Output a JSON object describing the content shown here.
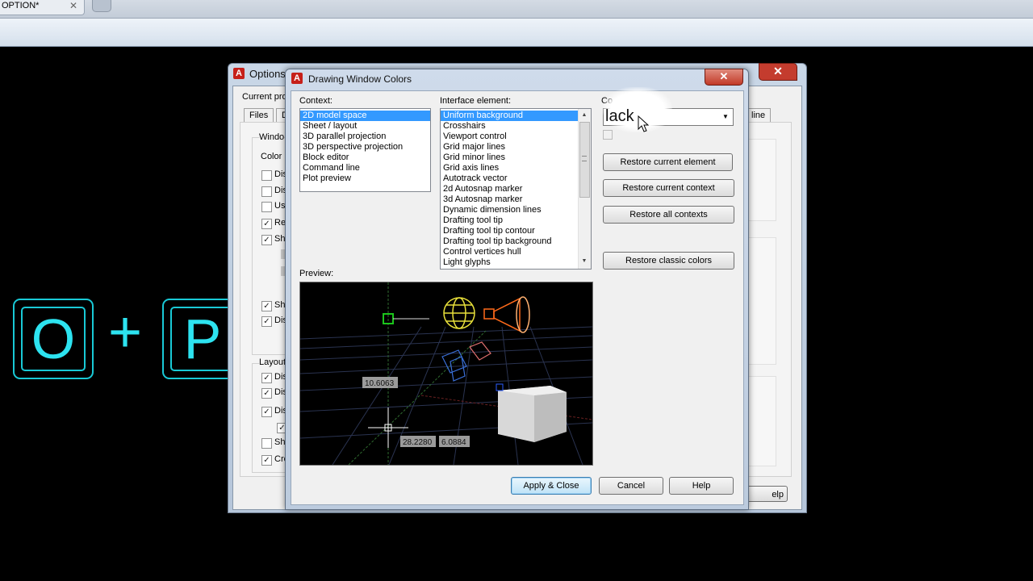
{
  "browser": {
    "tab_title": "OPTION*",
    "tab_close": "✕"
  },
  "overlay_keys": {
    "key1": "O",
    "plus": "+",
    "key2": "P"
  },
  "options_window": {
    "title": "Options",
    "current_profile_label": "Current pro",
    "tabs": [
      "Files",
      "D"
    ],
    "right_tab_fragment": "line",
    "window_label": "Windo",
    "color_label": "Color",
    "checkbox_fragments_top": [
      "Dis",
      "Dis",
      "Us",
      "Re",
      "Sh"
    ],
    "checkboxes_top_checked": [
      false,
      false,
      false,
      true,
      true
    ],
    "checkbox_fragments_mid": [
      "Sh",
      "Dis"
    ],
    "checkboxes_mid_checked": [
      true,
      true
    ],
    "layout_label": "Layout",
    "checkbox_fragments_bottom": [
      "Dis",
      "Dis",
      "Dis",
      "Sh",
      "Cre"
    ],
    "checkboxes_bottom_checked": [
      true,
      true,
      true,
      false,
      true
    ],
    "help_fragment": "elp",
    "close": "✕"
  },
  "dialog": {
    "title": "Drawing Window Colors",
    "close": "✕",
    "context_label": "Context:",
    "context_items": [
      "2D model space",
      "Sheet / layout",
      "3D parallel projection",
      "3D perspective projection",
      "Block editor",
      "Command line",
      "Plot preview"
    ],
    "context_selected": 0,
    "interface_label": "Interface element:",
    "interface_items": [
      "Uniform background",
      "Crosshairs",
      "Viewport control",
      "Grid major lines",
      "Grid minor lines",
      "Grid axis lines",
      "Autotrack vector",
      "2d Autosnap marker",
      "3d Autosnap marker",
      "Dynamic dimension lines",
      "Drafting tool tip",
      "Drafting tool tip contour",
      "Drafting tool tip background",
      "Control vertices hull",
      "Light glyphs"
    ],
    "interface_selected": 0,
    "color_label_fragment": "Co",
    "color_value": "lack",
    "buttons": {
      "restore_element": "Restore current element",
      "restore_context": "Restore current context",
      "restore_all": "Restore all contexts",
      "restore_classic": "Restore classic colors",
      "apply_close": "Apply & Close",
      "cancel": "Cancel",
      "help": "Help"
    },
    "preview_label": "Preview:",
    "preview_dims": {
      "a": "10.6063",
      "b": "28.2280",
      "c": "6.0884"
    },
    "colors": {
      "background": "#000000",
      "crosshair": "#ffffff",
      "accent_selected": "#3399ff"
    }
  }
}
